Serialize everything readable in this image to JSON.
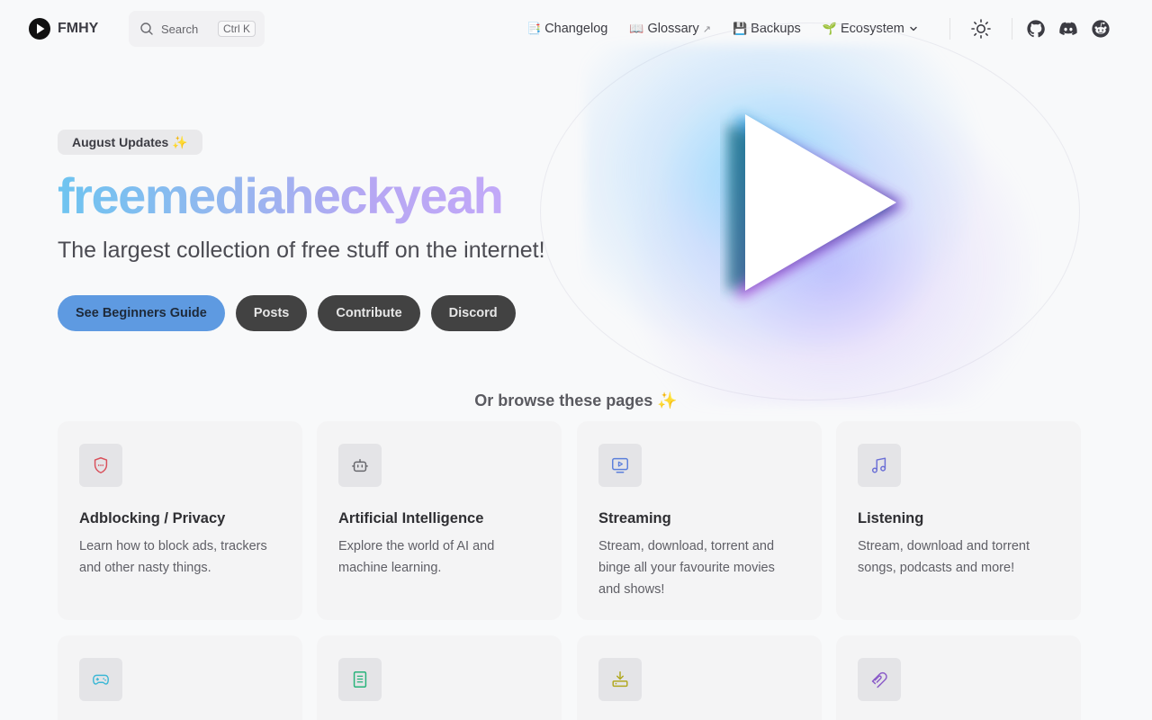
{
  "brand": {
    "name": "FMHY"
  },
  "search": {
    "label": "Search",
    "shortcut": "Ctrl K"
  },
  "nav": {
    "links": [
      {
        "emoji": "📑",
        "label": "Changelog"
      },
      {
        "emoji": "📖",
        "label": "Glossary",
        "external": "↗"
      },
      {
        "emoji": "💾",
        "label": "Backups"
      },
      {
        "emoji": "🌱",
        "label": "Ecosystem"
      }
    ],
    "icons": [
      "sun-icon",
      "github-icon",
      "discord-icon",
      "reddit-icon"
    ]
  },
  "hero": {
    "badge": "August Updates ✨",
    "title": "freemediaheckyeah",
    "tagline": "The largest collection of free stuff on the internet!",
    "actions": [
      {
        "label": "See Beginners Guide",
        "style": "primary"
      },
      {
        "label": "Posts",
        "style": "alt"
      },
      {
        "label": "Contribute",
        "style": "alt"
      },
      {
        "label": "Discord",
        "style": "alt"
      }
    ]
  },
  "browse": {
    "heading": "Or browse these pages ✨",
    "cards": [
      {
        "icon": "shield-icon",
        "color": "#d9505b",
        "title": "Adblocking / Privacy",
        "desc": "Learn how to block ads, trackers and other nasty things."
      },
      {
        "icon": "robot-icon",
        "color": "#67676c",
        "title": "Artificial Intelligence",
        "desc": "Explore the world of AI and machine learning."
      },
      {
        "icon": "tv-play-icon",
        "color": "#5b7fdb",
        "title": "Streaming",
        "desc": "Stream, download, torrent and binge all your favourite movies and shows!"
      },
      {
        "icon": "music-note-icon",
        "color": "#6b6fd6",
        "title": "Listening",
        "desc": "Stream, download and torrent songs, podcasts and more!"
      },
      {
        "icon": "gamepad-icon",
        "color": "#3db8d6",
        "title": "",
        "desc": ""
      },
      {
        "icon": "book-icon",
        "color": "#26b37a",
        "title": "",
        "desc": ""
      },
      {
        "icon": "download-tray-icon",
        "color": "#b1a81f",
        "title": "",
        "desc": ""
      },
      {
        "icon": "magnet-icon",
        "color": "#8b5cc9",
        "title": "",
        "desc": ""
      }
    ]
  }
}
